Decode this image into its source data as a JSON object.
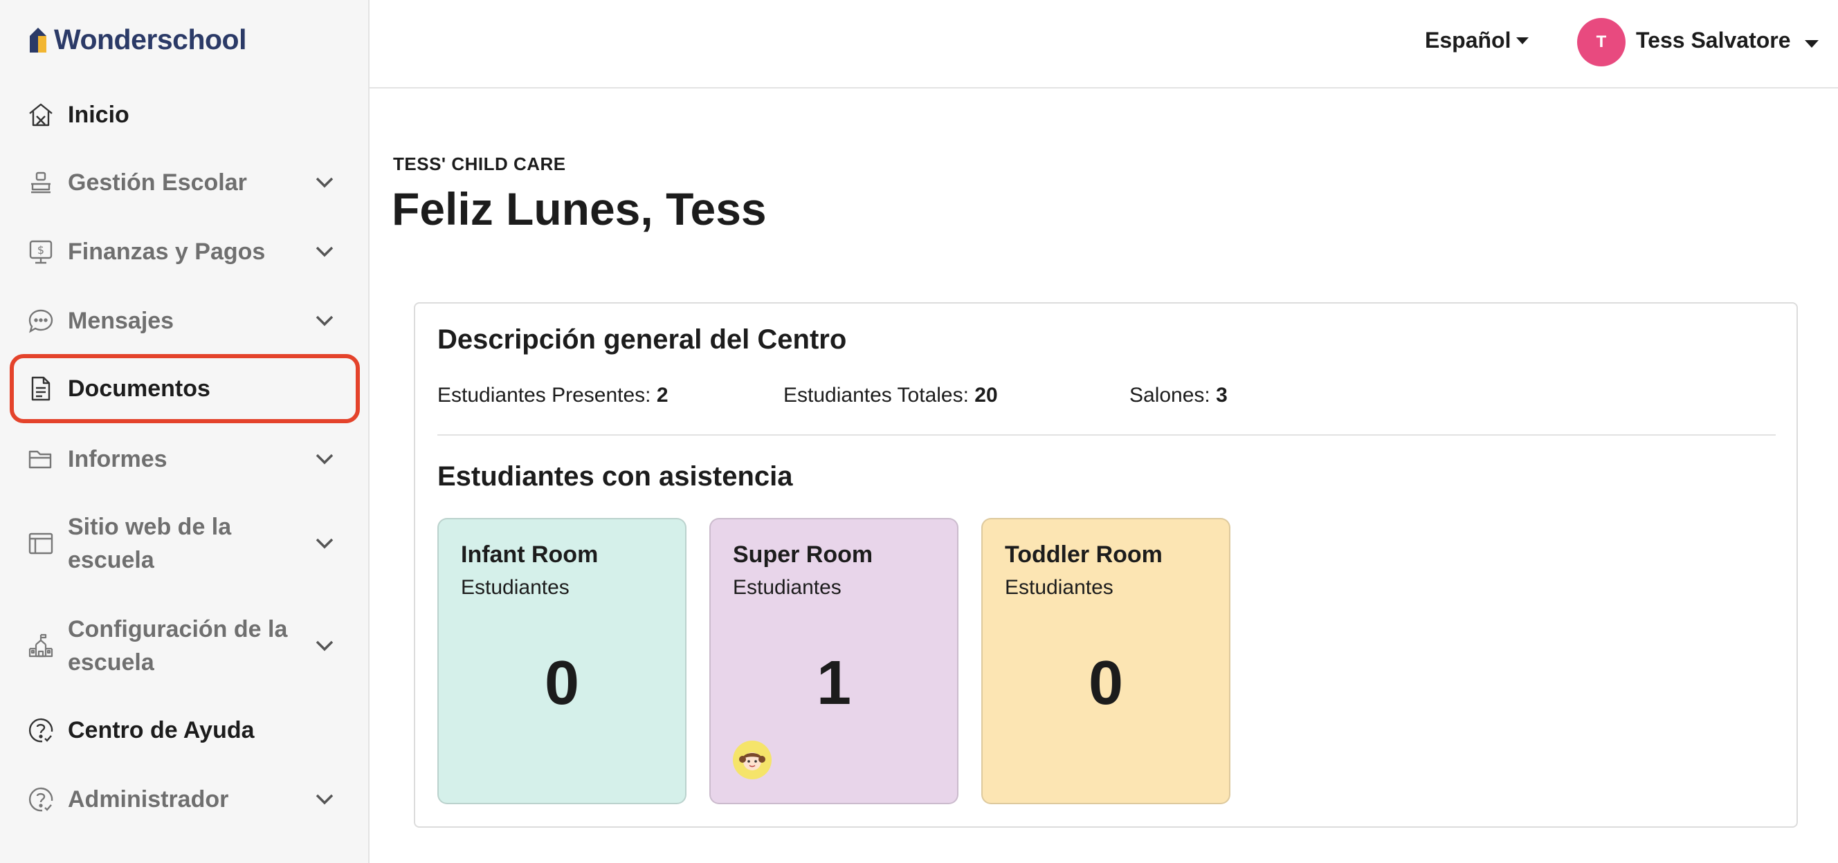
{
  "app": {
    "logo_text": "Wonderschool"
  },
  "sidebar": {
    "items": [
      {
        "label": "Inicio",
        "icon": "home-icon",
        "has_chevron": false
      },
      {
        "label": "Gestión Escolar",
        "icon": "desk-icon",
        "has_chevron": true
      },
      {
        "label": "Finanzas y Pagos",
        "icon": "finance-icon",
        "has_chevron": true
      },
      {
        "label": "Mensajes",
        "icon": "chat-icon",
        "has_chevron": true
      },
      {
        "label": "Documentos",
        "icon": "document-icon",
        "has_chevron": false,
        "active": true
      },
      {
        "label": "Informes",
        "icon": "folder-icon",
        "has_chevron": true
      },
      {
        "label": "Sitio web de la escuela",
        "icon": "browser-icon",
        "has_chevron": true
      },
      {
        "label": "Configuración de la escuela",
        "icon": "school-icon",
        "has_chevron": true
      },
      {
        "label": "Centro de Ayuda",
        "icon": "help-icon",
        "has_chevron": false
      },
      {
        "label": "Administrador",
        "icon": "help-icon",
        "has_chevron": true
      }
    ]
  },
  "header": {
    "language": "Español",
    "user_initial": "T",
    "user_name": "Tess Salvatore"
  },
  "main": {
    "school_name": "TESS' CHILD CARE",
    "greeting": "Feliz Lunes, Tess",
    "overview": {
      "title": "Descripción general del Centro",
      "stats": [
        {
          "label": "Estudiantes Presentes:",
          "value": "2"
        },
        {
          "label": "Estudiantes Totales:",
          "value": "20"
        },
        {
          "label": "Salones:",
          "value": "3"
        }
      ]
    },
    "attendance": {
      "title": "Estudiantes con asistencia",
      "rooms": [
        {
          "name": "Infant Room",
          "sub": "Estudiantes",
          "count": "0",
          "color": "#d5f0ea"
        },
        {
          "name": "Super Room",
          "sub": "Estudiantes",
          "count": "1",
          "color": "#e8d5ea"
        },
        {
          "name": "Toddler Room",
          "sub": "Estudiantes",
          "count": "0",
          "color": "#fce5b3"
        }
      ]
    }
  },
  "colors": {
    "accent_highlight": "#e4432b",
    "brand": "#2b3a67",
    "avatar": "#e84a7f"
  }
}
